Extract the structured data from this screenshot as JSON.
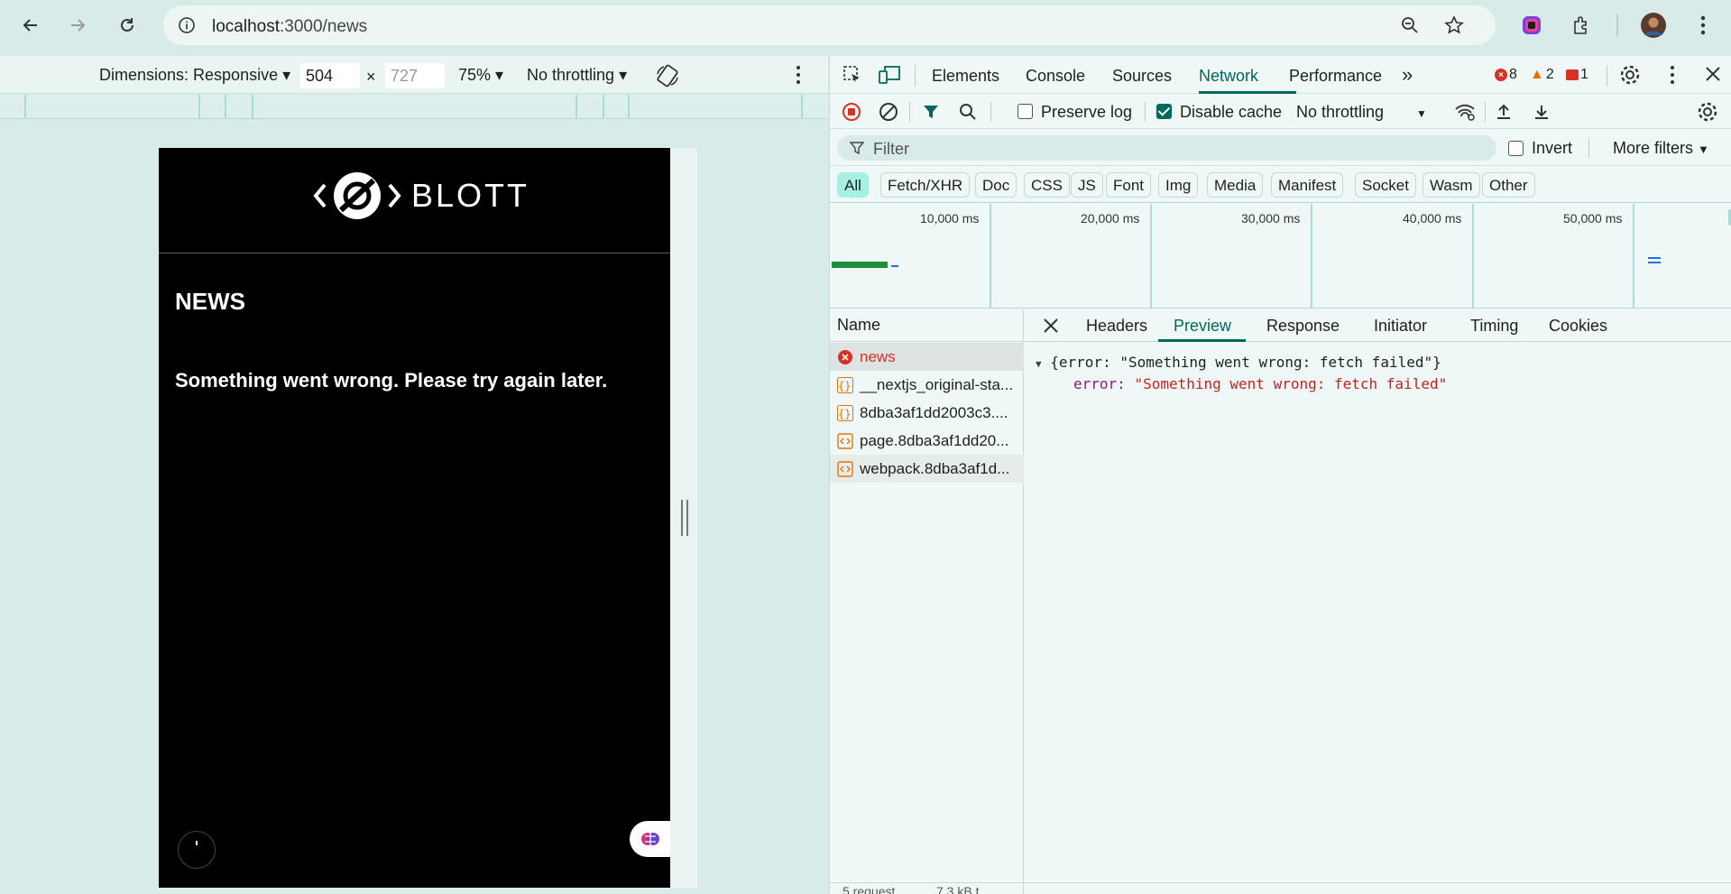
{
  "browser": {
    "url_host": "localhost",
    "url_path": ":3000/news",
    "icons": [
      "back-icon",
      "forward-icon",
      "reload-icon",
      "site-info-icon",
      "zoom-icon",
      "bookmark-star-icon",
      "extension-icon",
      "puzzle-icon",
      "profile-avatar",
      "menu-icon"
    ]
  },
  "device_toolbar": {
    "dimensions_label": "Dimensions: Responsive",
    "width": "504",
    "times": "×",
    "height_placeholder": "727",
    "zoom": "75%",
    "throttling": "No throttling"
  },
  "page": {
    "logo_text": "BLOTT",
    "title": "NEWS",
    "error_message": "Something went wrong. Please try again later."
  },
  "devtools": {
    "tabs": [
      "Elements",
      "Console",
      "Sources",
      "Network",
      "Performance"
    ],
    "active_tab": "Network",
    "more_tabs": "»",
    "errors": "8",
    "warnings": "2",
    "issues": "1"
  },
  "network": {
    "preserve_log": "Preserve log",
    "disable_cache": "Disable cache",
    "throttling": "No throttling",
    "filter_placeholder": "Filter",
    "invert": "Invert",
    "more_filters": "More filters",
    "types": [
      "All",
      "Fetch/XHR",
      "Doc",
      "CSS",
      "JS",
      "Font",
      "Img",
      "Media",
      "Manifest",
      "Socket",
      "Wasm",
      "Other"
    ],
    "active_type": "All",
    "timeline_labels": [
      "10,000 ms",
      "20,000 ms",
      "30,000 ms",
      "40,000 ms",
      "50,000 ms"
    ],
    "name_header": "Name",
    "requests": [
      {
        "name": "news",
        "icon": "error-icon"
      },
      {
        "name": "__nextjs_original-sta...",
        "icon": "json-icon"
      },
      {
        "name": "8dba3af1dd2003c3....",
        "icon": "json-icon"
      },
      {
        "name": "page.8dba3af1dd20...",
        "icon": "script-icon"
      },
      {
        "name": "webpack.8dba3af1d...",
        "icon": "script-icon"
      }
    ],
    "status_left": "5 request",
    "status_right": "7.3 kB t"
  },
  "detail": {
    "tabs": [
      "Headers",
      "Preview",
      "Response",
      "Initiator",
      "Timing",
      "Cookies"
    ],
    "active_tab": "Preview",
    "preview_summary": "{error: \"Something went wrong: fetch failed\"}",
    "preview_key": "error:",
    "preview_value": "\"Something went wrong: fetch failed\""
  },
  "colors": {
    "accent": "#00695c",
    "error": "#d93025",
    "warning": "#e37400",
    "chip_active": "#a5efe3"
  }
}
